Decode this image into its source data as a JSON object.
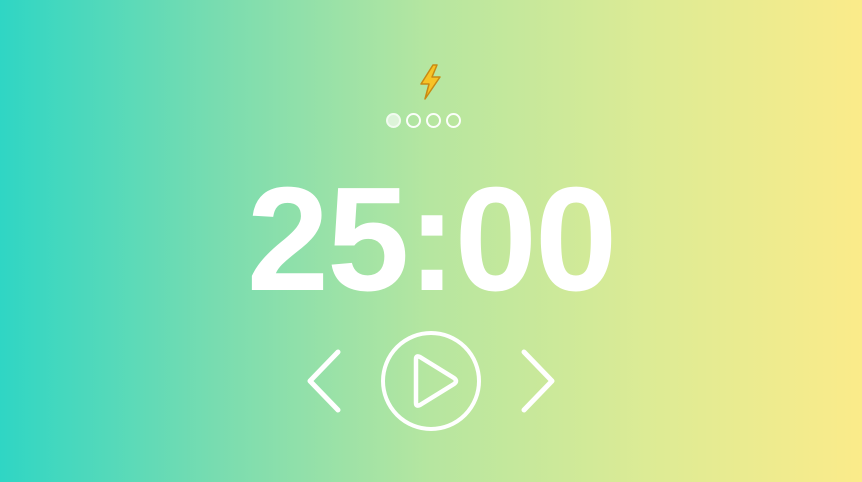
{
  "header": {
    "mode_icon": "lightning-bolt-icon"
  },
  "sessions": {
    "total": 4,
    "completed": 1
  },
  "timer": {
    "display": "25:00"
  },
  "controls": {
    "prev_icon": "chevron-left-icon",
    "play_icon": "play-icon",
    "next_icon": "chevron-right-icon"
  },
  "colors": {
    "gradient_start": "#2fd6c4",
    "gradient_end": "#fbeb8a",
    "foreground": "#ffffff",
    "bolt_fill": "#f7c326",
    "bolt_outline": "#c98a12"
  }
}
